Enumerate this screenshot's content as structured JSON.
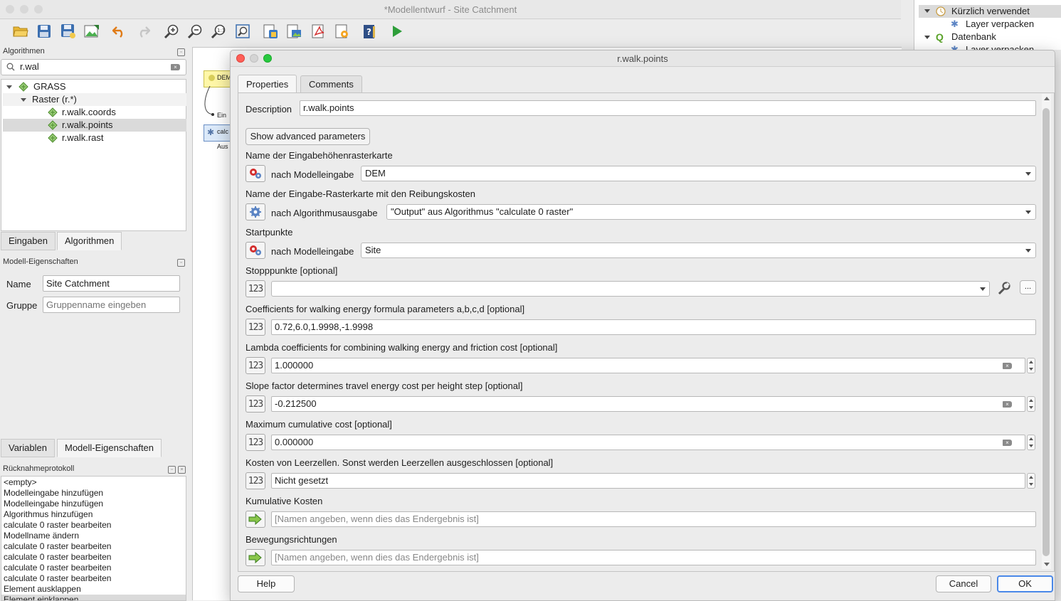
{
  "main_window": {
    "title": "*Modellentwurf - Site Catchment",
    "toolbar_icons": [
      "open-folder-icon",
      "save-icon",
      "save-as-icon",
      "export-image-icon",
      "undo-icon",
      "redo-icon",
      "zoom-in-icon",
      "zoom-out-icon",
      "zoom-actual-icon",
      "zoom-full-icon",
      "export-python-icon",
      "export-image2-icon",
      "export-pdf-icon",
      "export-svg-icon",
      "help-icon",
      "run-icon"
    ]
  },
  "algorithms_panel": {
    "title": "Algorithmen",
    "search_value": "r.wal",
    "tree": {
      "root": "GRASS",
      "group": "Raster (r.*)",
      "items": [
        "r.walk.coords",
        "r.walk.points",
        "r.walk.rast"
      ],
      "selected": "r.walk.points"
    },
    "tabs": [
      "Eingaben",
      "Algorithmen"
    ],
    "active_tab": "Algorithmen"
  },
  "model_properties": {
    "title": "Modell-Eigenschaften",
    "name_label": "Name",
    "name_value": "Site Catchment",
    "group_label": "Gruppe",
    "group_placeholder": "Gruppenname eingeben",
    "tabs": [
      "Variablen",
      "Modell-Eigenschaften"
    ],
    "active_tab": "Modell-Eigenschaften"
  },
  "undo_history": {
    "title": "Rücknahmeprotokoll",
    "entries": [
      "<empty>",
      "Modelleingabe hinzufügen",
      "Modelleingabe hinzufügen",
      "Algorithmus hinzufügen",
      "calculate 0 raster bearbeiten",
      "Modellname ändern",
      "calculate 0 raster bearbeiten",
      "calculate 0 raster bearbeiten",
      "calculate 0 raster bearbeiten",
      "calculate 0 raster bearbeiten",
      "Element ausklappen",
      "Element einklappen"
    ]
  },
  "canvas": {
    "node_dem": "DEM",
    "label_ein": "Ein",
    "node_calc": "calc",
    "label_aus": "Aus"
  },
  "right_panel": {
    "recent_label": "Kürzlich verwendet",
    "recent_item": "Layer verpacken",
    "db_label": "Datenbank",
    "db_item": "Layer verpacken"
  },
  "dialog": {
    "title": "r.walk.points",
    "tabs": [
      "Properties",
      "Comments"
    ],
    "active_tab": "Properties",
    "description_label": "Description",
    "description_value": "r.walk.points",
    "advanced_button": "Show advanced parameters",
    "params": {
      "elevation": {
        "label": "Name der Eingabehöhenrasterkarte",
        "source": "nach Modelleingabe",
        "value": "DEM"
      },
      "friction": {
        "label": "Name der Eingabe-Rasterkarte mit den Reibungskosten",
        "source": "nach Algorithmusausgabe",
        "value": "\"Output\" aus Algorithmus \"calculate 0 raster\""
      },
      "start": {
        "label": "Startpunkte",
        "source": "nach Modelleingabe",
        "value": "Site"
      },
      "stop": {
        "label": "Stopppunkte [optional]",
        "value": ""
      },
      "walk_coeff": {
        "label": "Coefficients for walking energy formula parameters a,b,c,d [optional]",
        "value": "0.72,6.0,1.9998,-1.9998"
      },
      "lambda": {
        "label": "Lambda coefficients for combining walking energy and friction cost [optional]",
        "value": "1.000000"
      },
      "slope": {
        "label": "Slope factor determines travel energy cost per height step [optional]",
        "value": "-0.212500"
      },
      "max_cost": {
        "label": "Maximum cumulative cost [optional]",
        "value": "0.000000"
      },
      "null_cost": {
        "label": "Kosten von Leerzellen. Sonst werden Leerzellen ausgeschlossen [optional]",
        "value": "Nicht gesetzt"
      },
      "output": {
        "label": "Kumulative Kosten",
        "placeholder": "[Namen angeben, wenn dies das Endergebnis ist]"
      },
      "outdir": {
        "label": "Bewegungsrichtungen",
        "placeholder": "[Namen angeben, wenn dies das Endergebnis ist]"
      }
    },
    "num_glyph": "123",
    "browse_button": "...",
    "help_button": "Help",
    "cancel_button": "Cancel",
    "ok_button": "OK"
  },
  "colors": {
    "accent": "#2a6edb",
    "node_input": "#fff7a8",
    "node_algo": "#dbe9f9",
    "selected_row": "#dadada"
  }
}
